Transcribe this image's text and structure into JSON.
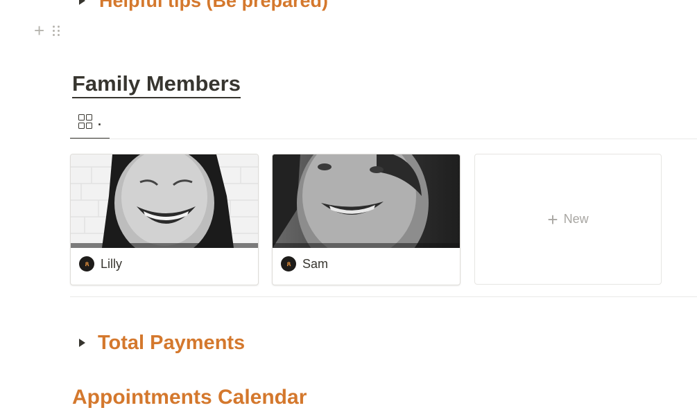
{
  "top_toggle": {
    "label": "Helpful tips (Be prepared)"
  },
  "family_section": {
    "title": "Family Members",
    "view_tab_label": ".",
    "cards": [
      {
        "name": "Lilly",
        "avatar_icon": "people-icon"
      },
      {
        "name": "Sam",
        "avatar_icon": "people-icon"
      }
    ],
    "new_label": "New"
  },
  "total_payments": {
    "label": "Total Payments"
  },
  "calendar_section": {
    "title": "Appointments Calendar"
  },
  "colors": {
    "accent": "#d4782d",
    "text": "#37352f",
    "muted": "#a8a6a2",
    "avatar_bg": "#1e1c1a",
    "avatar_fg": "#e38f3b"
  }
}
